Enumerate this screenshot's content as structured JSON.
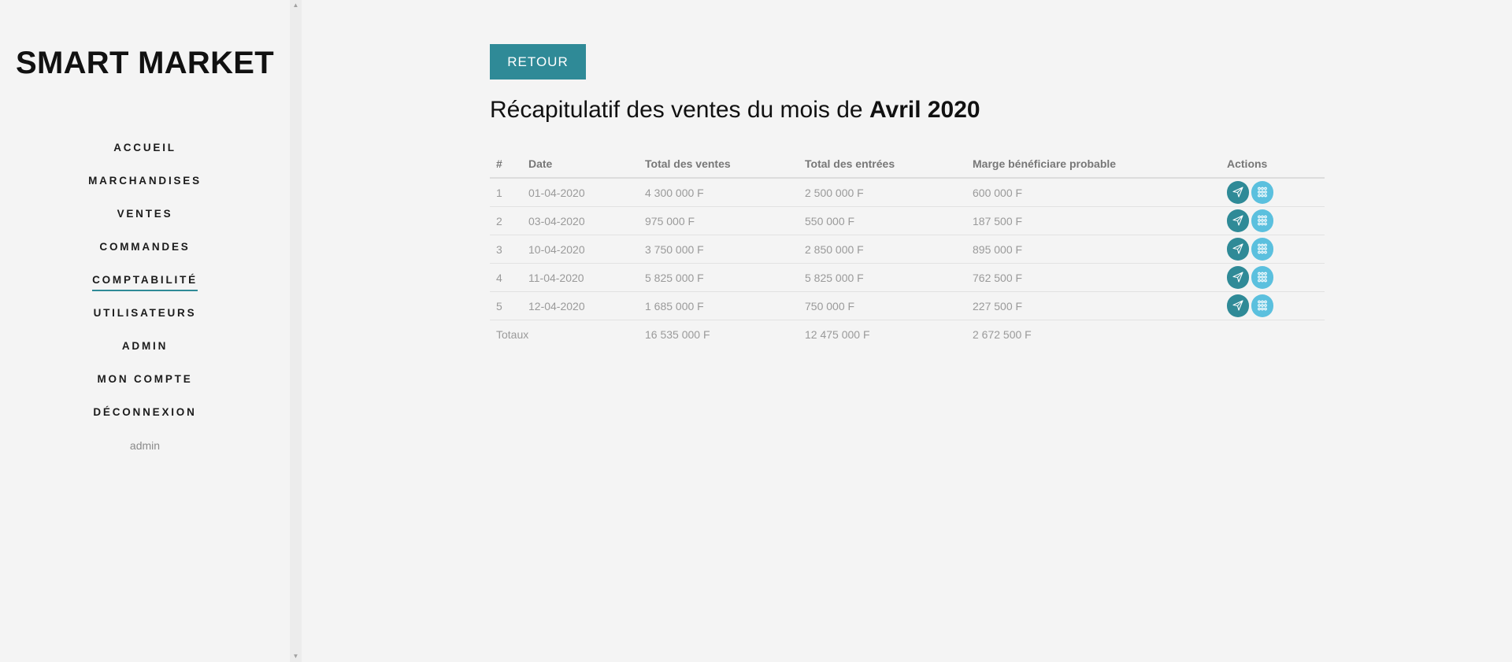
{
  "brand": "SMART MARKET",
  "nav": {
    "items": [
      {
        "label": "ACCUEIL",
        "active": false
      },
      {
        "label": "MARCHANDISES",
        "active": false
      },
      {
        "label": "VENTES",
        "active": false
      },
      {
        "label": "COMMANDES",
        "active": false
      },
      {
        "label": "COMPTABILITÉ",
        "active": true
      },
      {
        "label": "UTILISATEURS",
        "active": false
      },
      {
        "label": "ADMIN",
        "active": false
      },
      {
        "label": "MON COMPTE",
        "active": false
      },
      {
        "label": "DÉCONNEXION",
        "active": false
      }
    ],
    "user": "admin"
  },
  "main": {
    "back_label": "RETOUR",
    "heading_prefix": "Récapitulatif des ventes du mois de",
    "heading_period": "Avril 2020"
  },
  "table": {
    "headers": [
      "#",
      "Date",
      "Total des ventes",
      "Total des entrées",
      "Marge bénéficiare probable",
      "Actions"
    ],
    "rows": [
      [
        "1",
        "01-04-2020",
        "4 300 000 F",
        "2 500 000 F",
        "600 000 F"
      ],
      [
        "2",
        "03-04-2020",
        "975 000 F",
        "550 000 F",
        "187 500 F"
      ],
      [
        "3",
        "10-04-2020",
        "3 750 000 F",
        "2 850 000 F",
        "895 000 F"
      ],
      [
        "4",
        "11-04-2020",
        "5 825 000 F",
        "5 825 000 F",
        "762 500 F"
      ],
      [
        "5",
        "12-04-2020",
        "1 685 000 F",
        "750 000 F",
        "227 500 F"
      ]
    ],
    "totals": {
      "label": "Totaux",
      "ventes": "16 535 000 F",
      "entrees": "12 475 000 F",
      "marge": "2 672 500 F"
    }
  },
  "icons": {
    "send": "paper-plane-icon",
    "detail": "list-detail-icon"
  },
  "colors": {
    "accent": "#2f8a97",
    "info": "#5bc0de",
    "background": "#f4f4f4",
    "muted_text": "#9a9a9a"
  }
}
